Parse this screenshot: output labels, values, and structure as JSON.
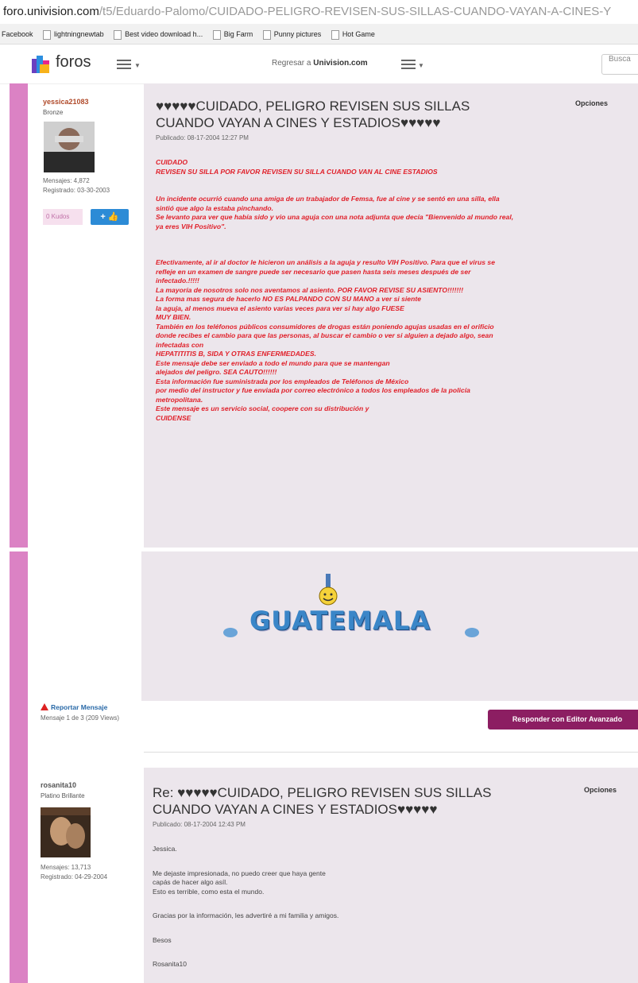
{
  "browser": {
    "url_host": "foro.univision.com",
    "url_path": "/t5/Eduardo-Palomo/CUIDADO-PELIGRO-REVISEN-SUS-SILLAS-CUANDO-VAYAN-A-CINES-Y",
    "bookmarks": [
      "Facebook",
      "lightningnewtab",
      "Best video download h...",
      "Big Farm",
      "Punny pictures",
      "Hot Game"
    ]
  },
  "nav": {
    "brand": "foros",
    "regresar_prefix": "Regresar a ",
    "regresar_site": "Univision.com",
    "search_placeholder": "Busca"
  },
  "post1": {
    "username": "yessica21083",
    "rank": "Bronze",
    "stats": [
      "Mensajes: 4,872",
      "Registrado: 03-30-2003"
    ],
    "kudos": "0 Kudos",
    "like_label": "+ 👍",
    "title_line1": "♥♥♥♥♥CUIDADO, PELIGRO REVISEN SUS SILLAS",
    "title_line2": "CUANDO VAYAN A CINES Y ESTADIOS♥♥♥♥♥",
    "date": "Publicado: 08-17-2004 12:27 PM",
    "options": "Opciones",
    "body_a": [
      "CUIDADO",
      "REVISEN SU SILLA POR FAVOR REVISEN SU SILLA CUANDO VAN AL CINE  ESTADIOS"
    ],
    "body_b": [
      "Un incidente ocurrió cuando una amiga de un trabajador de Femsa, fue al cine y se sentó en una silla, ella",
      "sintió que algo la estaba pinchando.",
      "Se levanto para ver que había sido y vio una aguja con una nota adjunta que decía \"Bienvenido al mundo real,",
      "ya eres VIH Positivo\"."
    ],
    "body_c": [
      "Efectivamente, al ir al doctor le hicieron un análisis a la aguja y resulto VIH Positivo. Para que el virus se",
      "refleje en un examen de sangre puede ser necesario que pasen hasta seis meses después de ser",
      "infectado.!!!!!",
      "La mayoría de nosotros solo nos aventamos al asiento. POR FAVOR REVISE SU ASIENTO!!!!!!!",
      "La forma mas segura de hacerlo NO ES PALPANDO CON SU MANO a ver si siente",
      "la aguja, al menos mueva el asiento varias veces para ver si hay algo FUESE",
      "MUY BIEN.",
      "También en los teléfonos públicos consumidores de drogas están poniendo agujas usadas en el orificio",
      "donde recibes el cambio para que las personas, al buscar el cambio o ver si alguien a dejado algo, sean",
      "infectadas con",
      "HEPATITITIS B, SIDA Y OTRAS ENFERMEDADES.",
      "Este mensaje debe ser enviado a todo el mundo para que se mantengan",
      "alejados del peligro. SEA CAUTO!!!!!!",
      "Esta información fue suministrada por los empleados de Teléfonos de México",
      "por medio del instructor y fue enviada por correo electrónico a todos los empleados de la policía",
      "metropolitana.",
      "Este mensaje es un servicio social, coopere con su distribución y",
      "CUIDENSE"
    ],
    "gif_text": "GUATEMALA",
    "report": "Reportar Mensaje",
    "message_count": "Mensaje 1 de 3 (209 Views)",
    "reply_button": "Responder con Editor Avanzado"
  },
  "post2": {
    "username": "rosanita10",
    "rank": "Platino Brillante",
    "stats": [
      "Mensajes: 13,713",
      "Registrado: 04-29-2004"
    ],
    "title_line1": "Re: ♥♥♥♥♥CUIDADO, PELIGRO REVISEN SUS SILLAS",
    "title_line2": "CUANDO VAYAN A CINES Y ESTADIOS♥♥♥♥♥",
    "date": "Publicado: 08-17-2004 12:43 PM",
    "options": "Opciones",
    "body": {
      "greeting": "Jessica.",
      "lines": [
        "Me dejaste impresionada, no puedo creer que haya gente",
        "capás de hacer algo asíl.",
        "Esto es terrible, como esta el mundo."
      ],
      "thanks": "Gracias por la información, les advertiré a mi familia y amigos.",
      "besos": "Besos",
      "signature": "Rosanita10"
    }
  },
  "colors": {
    "accent_bar": "#db82c4",
    "post_bg": "#ece6ec",
    "alert_red": "#e0202a",
    "reply_button": "#8c1e62",
    "like_blue": "#2c8bd6"
  }
}
